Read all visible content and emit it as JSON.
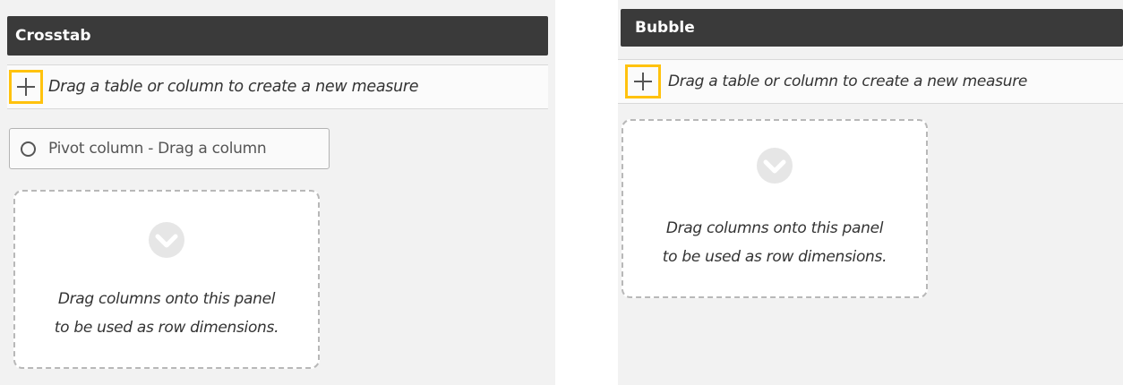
{
  "panels": [
    {
      "title": "Crosstab",
      "add_measure_hint": "Drag a table or column to create a new measure",
      "pivot_button_label": "Pivot column - Drag a column",
      "dropzone_lines": [
        "Drag columns onto this panel",
        "to be used as row dimensions."
      ]
    },
    {
      "title": "Bubble",
      "add_measure_hint": "Drag a table or column to create a new measure",
      "dropzone_lines": [
        "Drag columns onto this panel",
        "to be used as row dimensions."
      ]
    }
  ],
  "icons": {
    "add": "plus-icon",
    "pivot": "circle-icon",
    "dropzone": "chevron-down-icon"
  },
  "colors": {
    "header_bg": "#3a3a3a",
    "header_text": "#ffffff",
    "highlight": "#ffc20e",
    "panel_bg": "#f2f2f2"
  }
}
